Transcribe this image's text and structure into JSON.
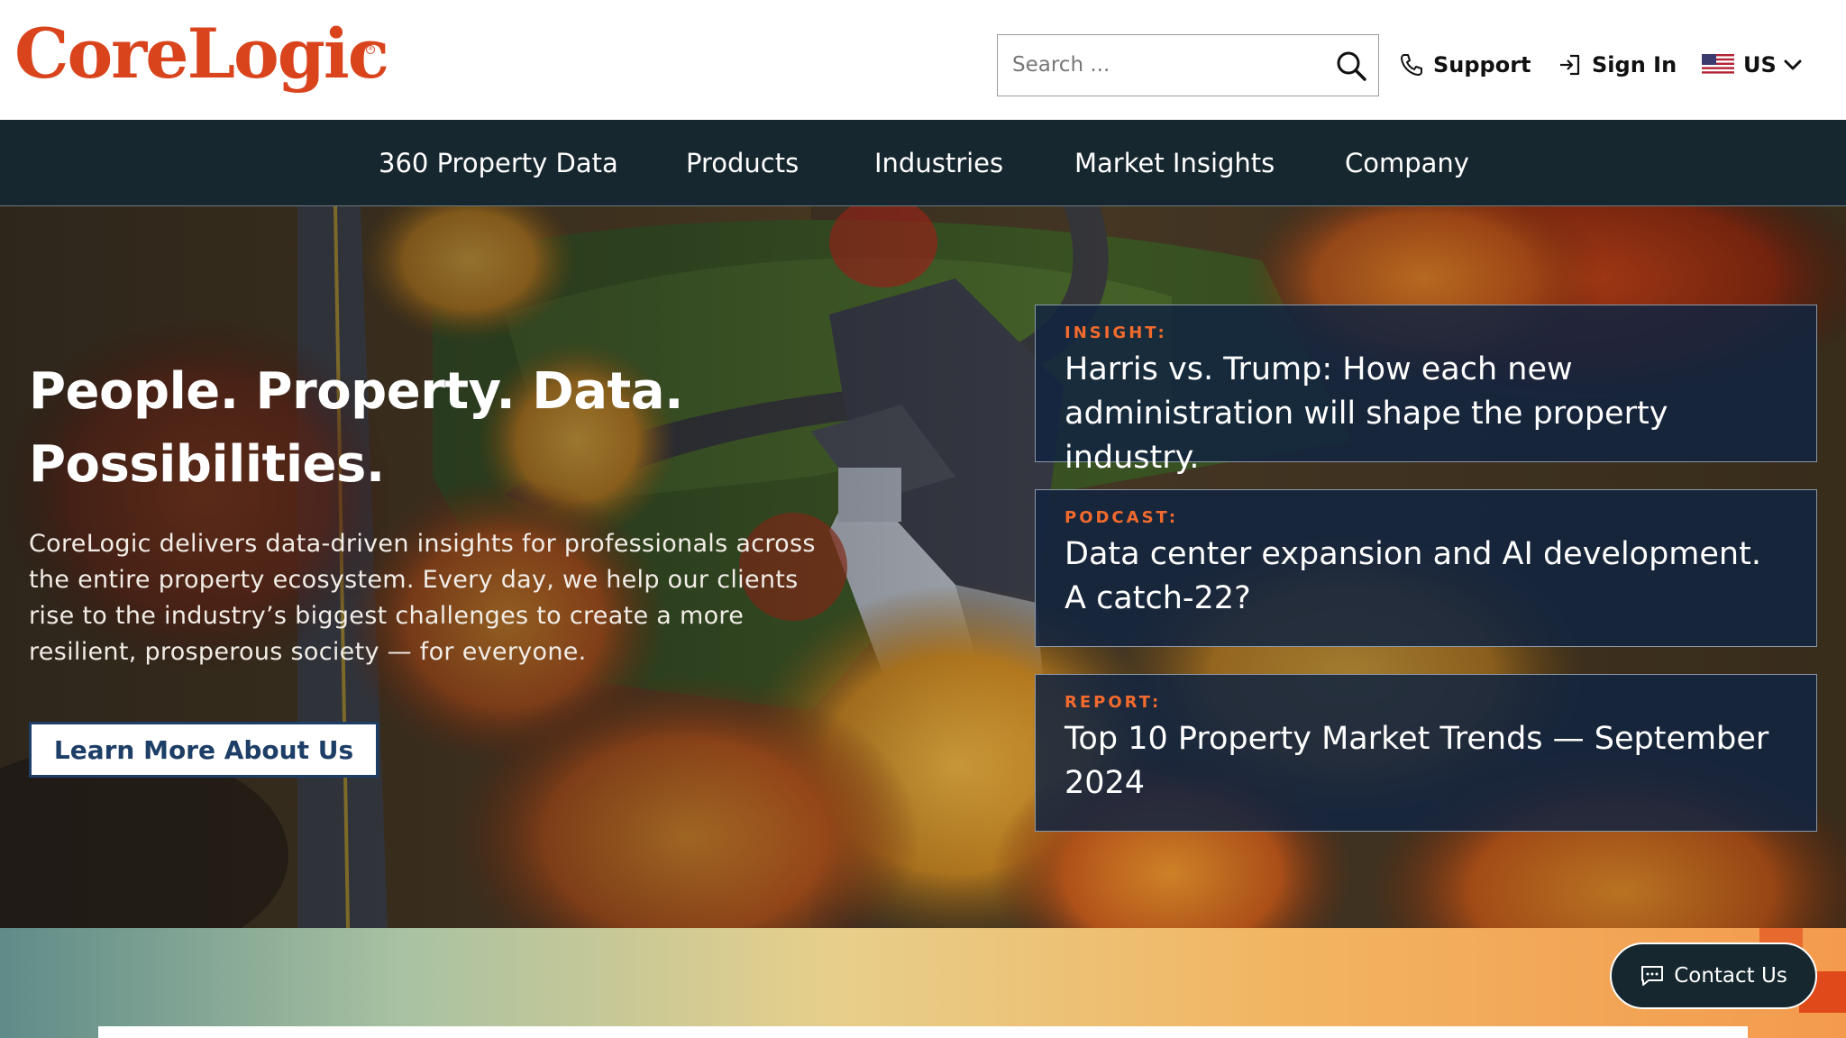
{
  "header": {
    "logo_text": "CoreLogic",
    "logo_mark": "®",
    "search_placeholder": "Search ...",
    "support_label": "Support",
    "signin_label": "Sign In",
    "locale_label": "US"
  },
  "nav": {
    "items": [
      "360 Property Data",
      "Products",
      "Industries",
      "Market Insights",
      "Company"
    ]
  },
  "hero": {
    "title_line1": "People. Property. Data.",
    "title_line2": "Possibilities.",
    "description": "CoreLogic delivers data-driven insights for professionals across the entire property ecosystem. Every day, we help our clients rise to the industry’s biggest challenges to create a more resilient, prosperous society — for everyone.",
    "button_label": "Learn More About Us",
    "cards": [
      {
        "tag": "INSIGHT:",
        "title": "Harris vs. Trump: How each new administration will shape the property industry."
      },
      {
        "tag": "PODCAST:",
        "title": "Data center expansion and AI development. A catch-22?"
      },
      {
        "tag": "REPORT:",
        "title": "Top 10 Property Market Trends — September 2024"
      }
    ]
  },
  "contact": {
    "label": "Contact Us"
  },
  "colors": {
    "brand": "#d9441d",
    "nav_bg": "#17272f",
    "card_bg": "#122440",
    "tag": "#f26a2e",
    "button_text": "#1d3e66"
  }
}
